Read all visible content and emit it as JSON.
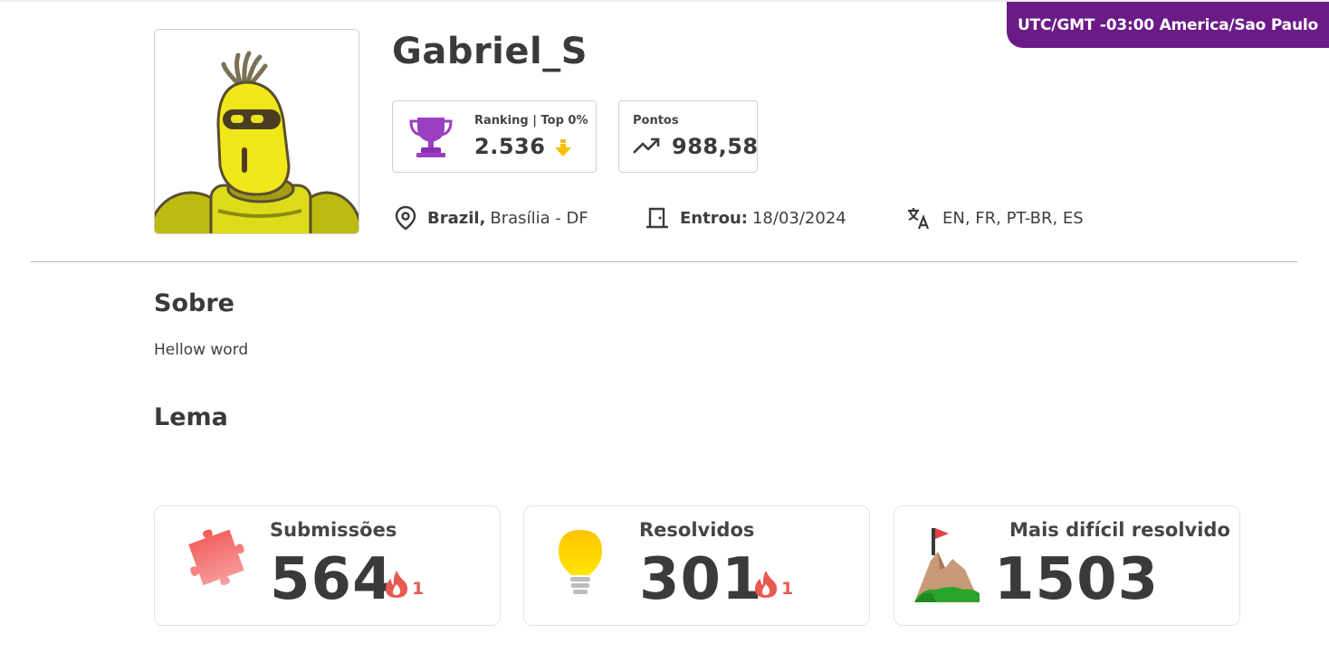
{
  "timezone": "UTC/GMT -03:00 America/Sao Paulo",
  "profile": {
    "username": "Gabriel_S",
    "ranking_label": "Ranking | Top 0%",
    "ranking_value": "2.536",
    "points_label": "Pontos",
    "points_value": "988,58",
    "country": "Brazil,",
    "city": "Brasília - DF",
    "joined_label": "Entrou:",
    "joined_date": "18/03/2024",
    "languages": "EN, FR, PT-BR, ES"
  },
  "about": {
    "title": "Sobre",
    "text": "Hellow word"
  },
  "motto": {
    "title": "Lema"
  },
  "stats": {
    "submissions": {
      "label": "Submissões",
      "value": "564",
      "streak": "1"
    },
    "solved": {
      "label": "Resolvidos",
      "value": "301",
      "streak": "1"
    },
    "hardest": {
      "label": "Mais difícil resolvido",
      "value": "1503"
    }
  },
  "colors": {
    "accent": "#6a1b86",
    "trophy": "#9b3fc2",
    "down_arrow": "#f2c200",
    "streak": "#e85a4f",
    "puzzle": "#f26b6b",
    "bulb": "#ffd000"
  }
}
